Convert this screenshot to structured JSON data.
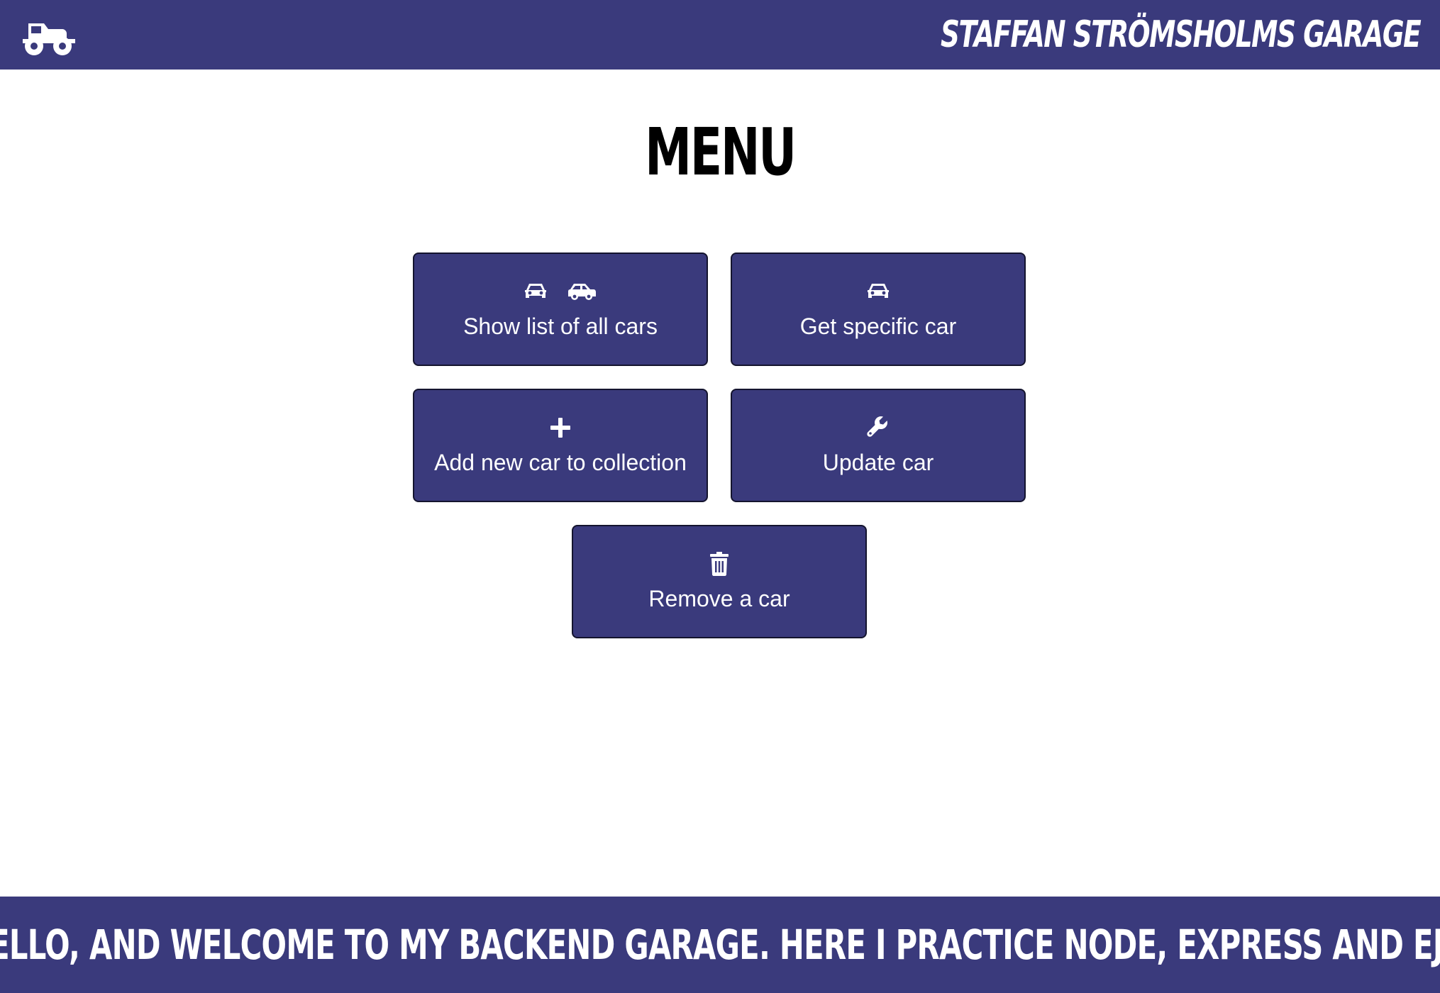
{
  "header": {
    "logo_icon": "monster-truck-icon",
    "title": "STAFFAN STRÖMSHOLMS GARAGE"
  },
  "main": {
    "title": "MENU",
    "buttons": [
      {
        "id": "show-all",
        "label": "Show list of all cars",
        "icons": [
          "car-front-icon",
          "car-side-icon"
        ]
      },
      {
        "id": "get-specific",
        "label": "Get specific car",
        "icons": [
          "car-front-icon"
        ]
      },
      {
        "id": "add",
        "label": "Add new car to collection",
        "icons": [
          "plus-icon"
        ]
      },
      {
        "id": "update",
        "label": "Update car",
        "icons": [
          "wrench-icon"
        ]
      },
      {
        "id": "remove",
        "label": "Remove a car",
        "icons": [
          "trash-icon"
        ]
      }
    ]
  },
  "footer": {
    "text": "HELLO, AND WELCOME TO MY BACKEND GARAGE. HERE I PRACTICE NODE, EXPRESS AND EJS."
  },
  "colors": {
    "brand": "#3a3a7c",
    "button_border": "#14142e",
    "text_on_brand": "#ffffff",
    "heading": "#000000"
  }
}
